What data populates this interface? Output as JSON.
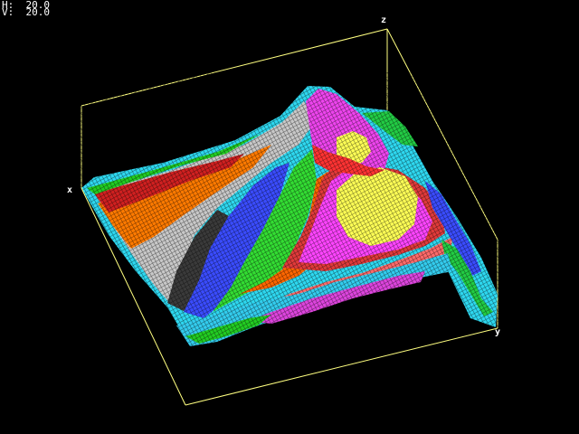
{
  "hud": {
    "h_label": "H:",
    "h_value": "20.0",
    "v_label": "V:",
    "v_value": "20.0"
  },
  "axes": {
    "x_label": "x",
    "y_label": "y",
    "z_label": "z"
  },
  "colors": {
    "background": "#000000",
    "bounding_box": "#ffff80",
    "text": "#ffffff",
    "band_colors": [
      "#33ccff",
      "#cccccc",
      "#ff6666",
      "#ff6600",
      "#ff3333",
      "#cc3333",
      "#3333ff",
      "#33cc33",
      "#ff6666",
      "#ff33ff",
      "#ffff66",
      "#00ffff"
    ]
  }
}
